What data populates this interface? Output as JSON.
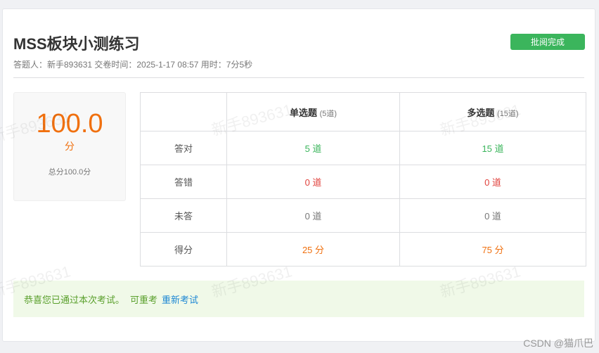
{
  "header": {
    "title": "MSS板块小测练习",
    "meta": "答题人：新手893631  交卷时间：2025-1-17 08:57 用时：7分5秒",
    "review_button": "批阅完成"
  },
  "score": {
    "value": "100.0",
    "unit": "分",
    "total": "总分100.0分"
  },
  "table": {
    "columns": [
      {
        "label": "单选题",
        "sub": "(5道)"
      },
      {
        "label": "多选题",
        "sub": "(15道)"
      }
    ],
    "rows": [
      {
        "label": "答对",
        "values": [
          "5 道",
          "15 道"
        ]
      },
      {
        "label": "答错",
        "values": [
          "0 道",
          "0 道"
        ]
      },
      {
        "label": "未答",
        "values": [
          "0 道",
          "0 道"
        ]
      },
      {
        "label": "得分",
        "values": [
          "25 分",
          "75 分"
        ]
      }
    ]
  },
  "notice": {
    "message": "恭喜您已通过本次考试。",
    "retake_label": "可重考",
    "retake_link": "重新考试"
  },
  "watermark": "新手893631",
  "footer": "CSDN @猫爪巴",
  "colors": {
    "accent_green": "#3bb55c",
    "score_orange": "#f0700f",
    "error_red": "#e0413c",
    "link_blue": "#1e88d4"
  }
}
